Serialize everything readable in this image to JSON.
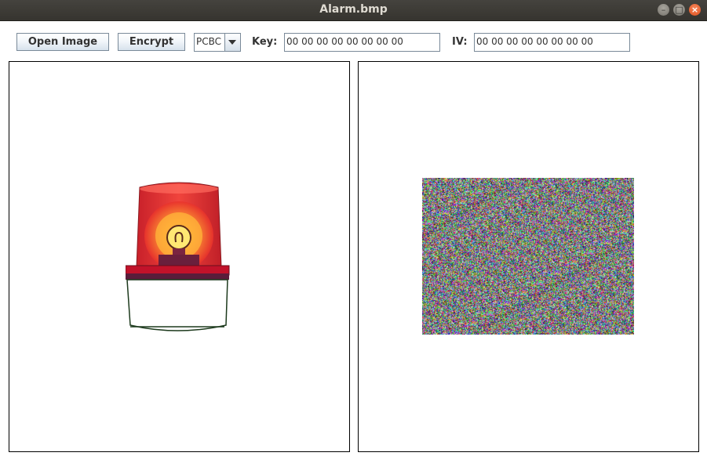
{
  "window": {
    "title": "Alarm.bmp",
    "controls": [
      "minimize-icon",
      "maximize-icon",
      "close-icon"
    ]
  },
  "toolbar": {
    "open_label": "Open Image",
    "encrypt_label": "Encrypt",
    "mode_selected": "PCBC",
    "key_label": "Key:",
    "key_value": "00 00 00 00 00 00 00 00",
    "iv_label": "IV:",
    "iv_value": "00 00 00 00 00 00 00 00"
  },
  "panels": {
    "original": {
      "image": "alarm-beacon-icon"
    },
    "encrypted": {
      "image": "encrypted-noise-image"
    }
  }
}
